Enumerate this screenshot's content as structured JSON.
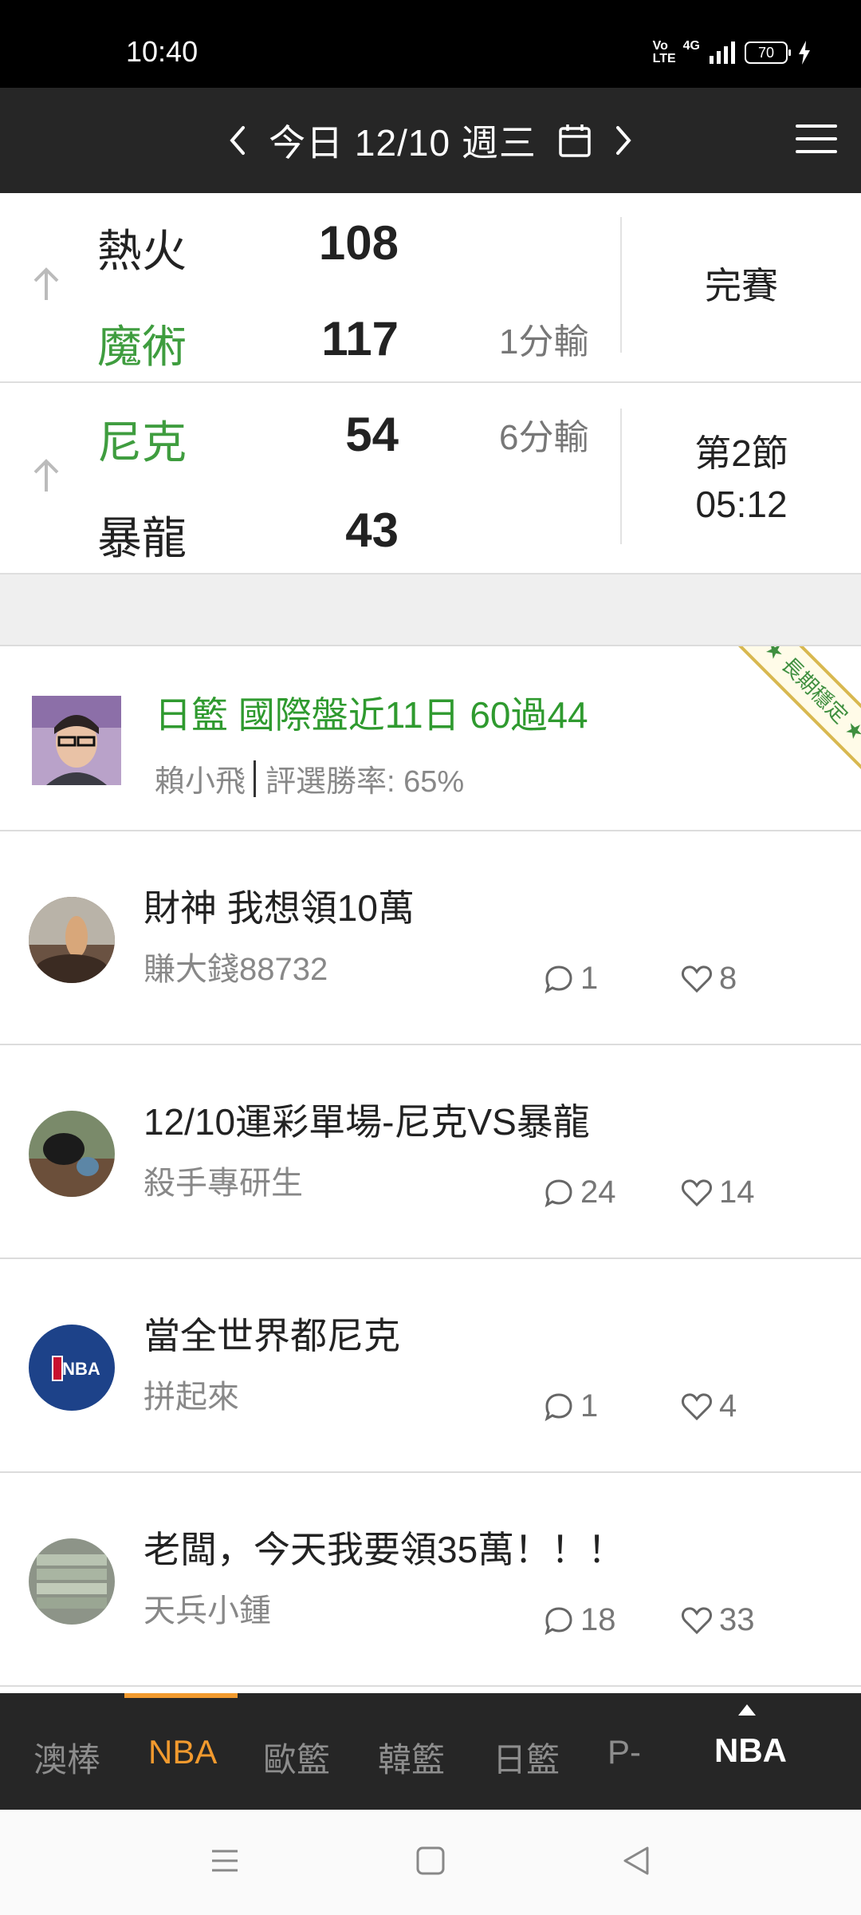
{
  "status_bar": {
    "time": "10:40",
    "volte": "Vo LTE",
    "network": "4G",
    "battery": "70"
  },
  "header": {
    "date_label": "今日 12/10 週三"
  },
  "games": [
    {
      "home": {
        "name": "熱火",
        "score": "108"
      },
      "away": {
        "name": "魔術",
        "score": "117"
      },
      "margin": "1分輸",
      "status": "完賽"
    },
    {
      "home": {
        "name": "尼克",
        "score": "54"
      },
      "away": {
        "name": "暴龍",
        "score": "43"
      },
      "margin": "6分輸",
      "status_line1": "第2節",
      "status_line2": "05:12"
    }
  ],
  "featured": {
    "title": "日籃 國際盤近11日 60過44",
    "author": "賴小飛",
    "win_rate": "評選勝率: 65%",
    "ribbon": "長期穩定"
  },
  "posts": [
    {
      "title": "財神 我想領10萬",
      "author": "賺大錢88732",
      "comments": "1",
      "likes": "8"
    },
    {
      "title": "12/10運彩單場-尼克VS暴龍",
      "author": "殺手專研生",
      "comments": "24",
      "likes": "14"
    },
    {
      "title": "當全世界都尼克",
      "author": "拼起來",
      "comments": "1",
      "likes": "4"
    },
    {
      "title": "老闆，今天我要領35萬！！！",
      "author": "天兵小鍾",
      "comments": "18",
      "likes": "33"
    }
  ],
  "tabs": [
    "澳棒",
    "NBA",
    "歐籃",
    "韓籃",
    "日籃",
    "P-"
  ],
  "tab_right": "NBA",
  "nba_logo_text": "NBA",
  "colors": {
    "header_bg": "#262626",
    "accent": "#f29a2e",
    "leader_green": "#3f9d3f"
  }
}
